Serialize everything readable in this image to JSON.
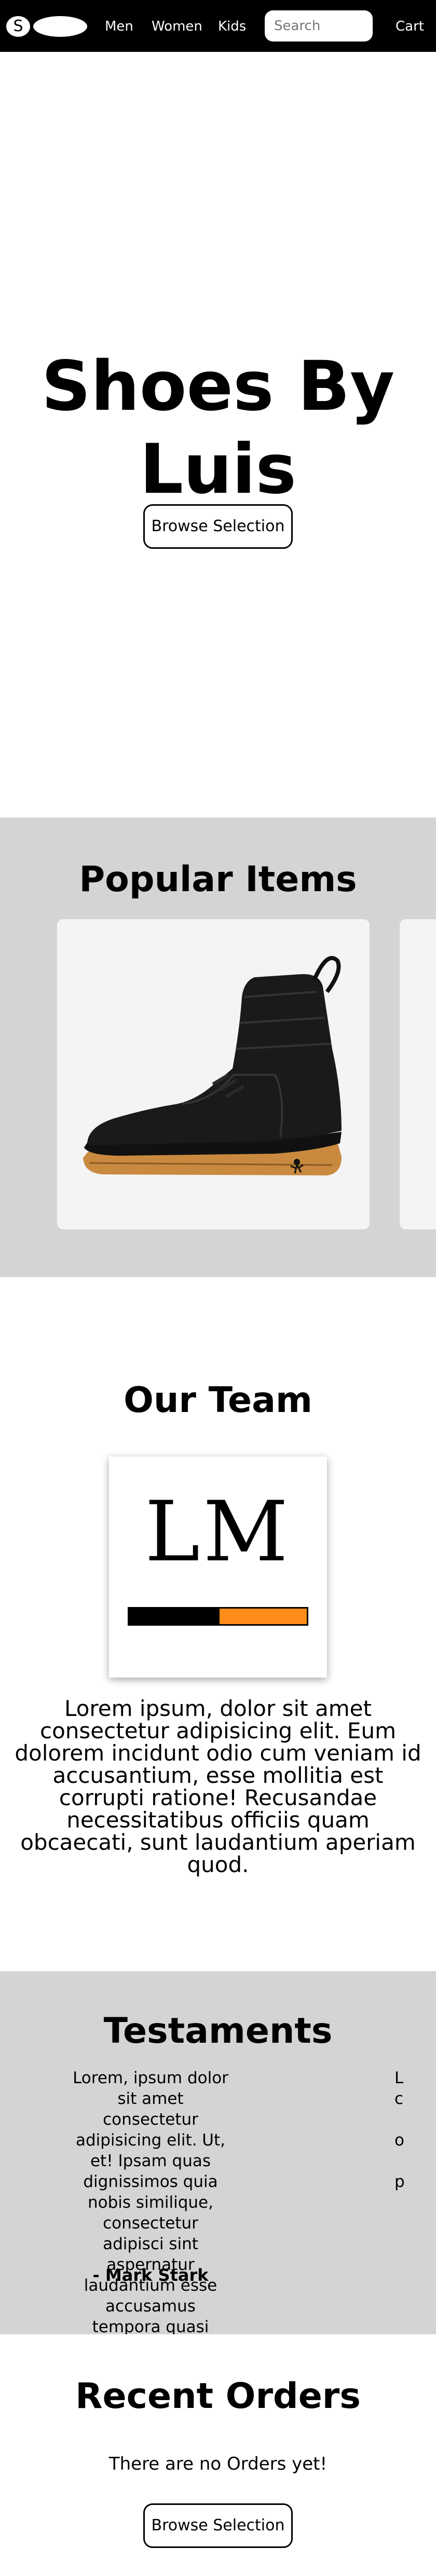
{
  "nav": {
    "logo_letter": "S",
    "links": [
      "Men",
      "Women",
      "Kids"
    ],
    "search_placeholder": "Search",
    "cart_label": "Cart"
  },
  "hero": {
    "title_line1": "Shoes By",
    "title_line2": "Luis",
    "button_label": "Browse Selection"
  },
  "popular": {
    "title": "Popular Items",
    "items": [
      {
        "image": "black-suede-high-top-sneaker-gum-sole"
      }
    ]
  },
  "team": {
    "title": "Our Team",
    "monogram": "LM",
    "progress": 0.5,
    "colors": {
      "progress_fill": "#ff8c19",
      "progress_track": "#000000"
    },
    "bio": "Lorem ipsum, dolor sit amet consectetur adipisicing elit. Eum dolorem incidunt odio cum veniam id accusantium, esse mollitia est corrupti ratione! Recusandae necessitatibus officiis quam obcaecati, sunt laudantium aperiam quod."
  },
  "testaments": {
    "title": "Testaments",
    "items": [
      {
        "quote": "Lorem, ipsum dolor sit amet consectetur adipisicing elit. Ut, et! Ipsam quas dignissimos quia nobis similique, consectetur adipisci sint aspernatur laudantium esse accusamus tempora quasi laboriosam ducimus dicta animi unde.",
        "author": "- Mark Stark"
      }
    ],
    "peek_fragments": [
      "L",
      "c",
      "",
      "o",
      "",
      "p"
    ]
  },
  "recent": {
    "title": "Recent Orders",
    "empty_text": "There are no Orders yet!",
    "button_label": "Browse Selection"
  },
  "colors": {
    "nav_bg": "#000000",
    "section_gray": "#d4d4d4",
    "accent_orange": "#ff8c19"
  }
}
